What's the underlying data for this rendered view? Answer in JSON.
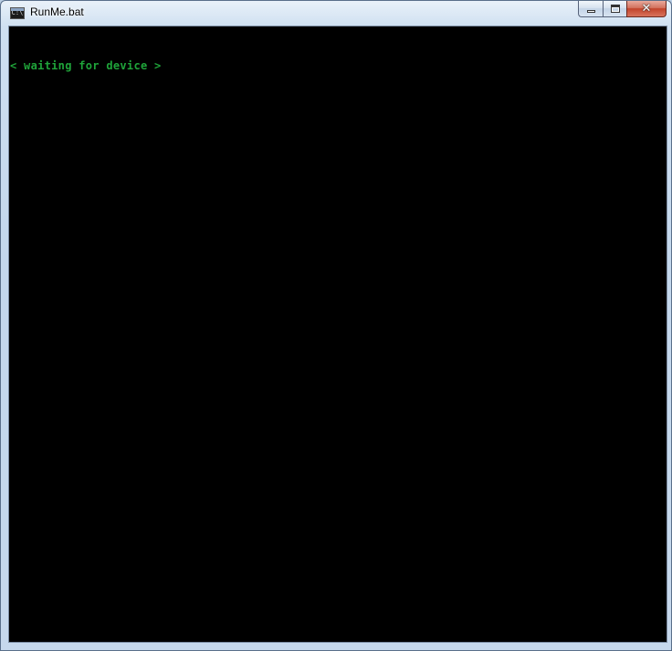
{
  "window": {
    "title": "RunMe.bat",
    "icon": "console-icon",
    "icon_text": "C:\\"
  },
  "caption_buttons": {
    "minimize_icon": "minimize-icon",
    "maximize_icon": "maximize-icon",
    "close_icon": "close-icon",
    "close_glyph": "✕"
  },
  "console": {
    "background_color": "#000000",
    "text_color": "#1fa43a",
    "lines": [
      "< waiting for device >"
    ]
  }
}
